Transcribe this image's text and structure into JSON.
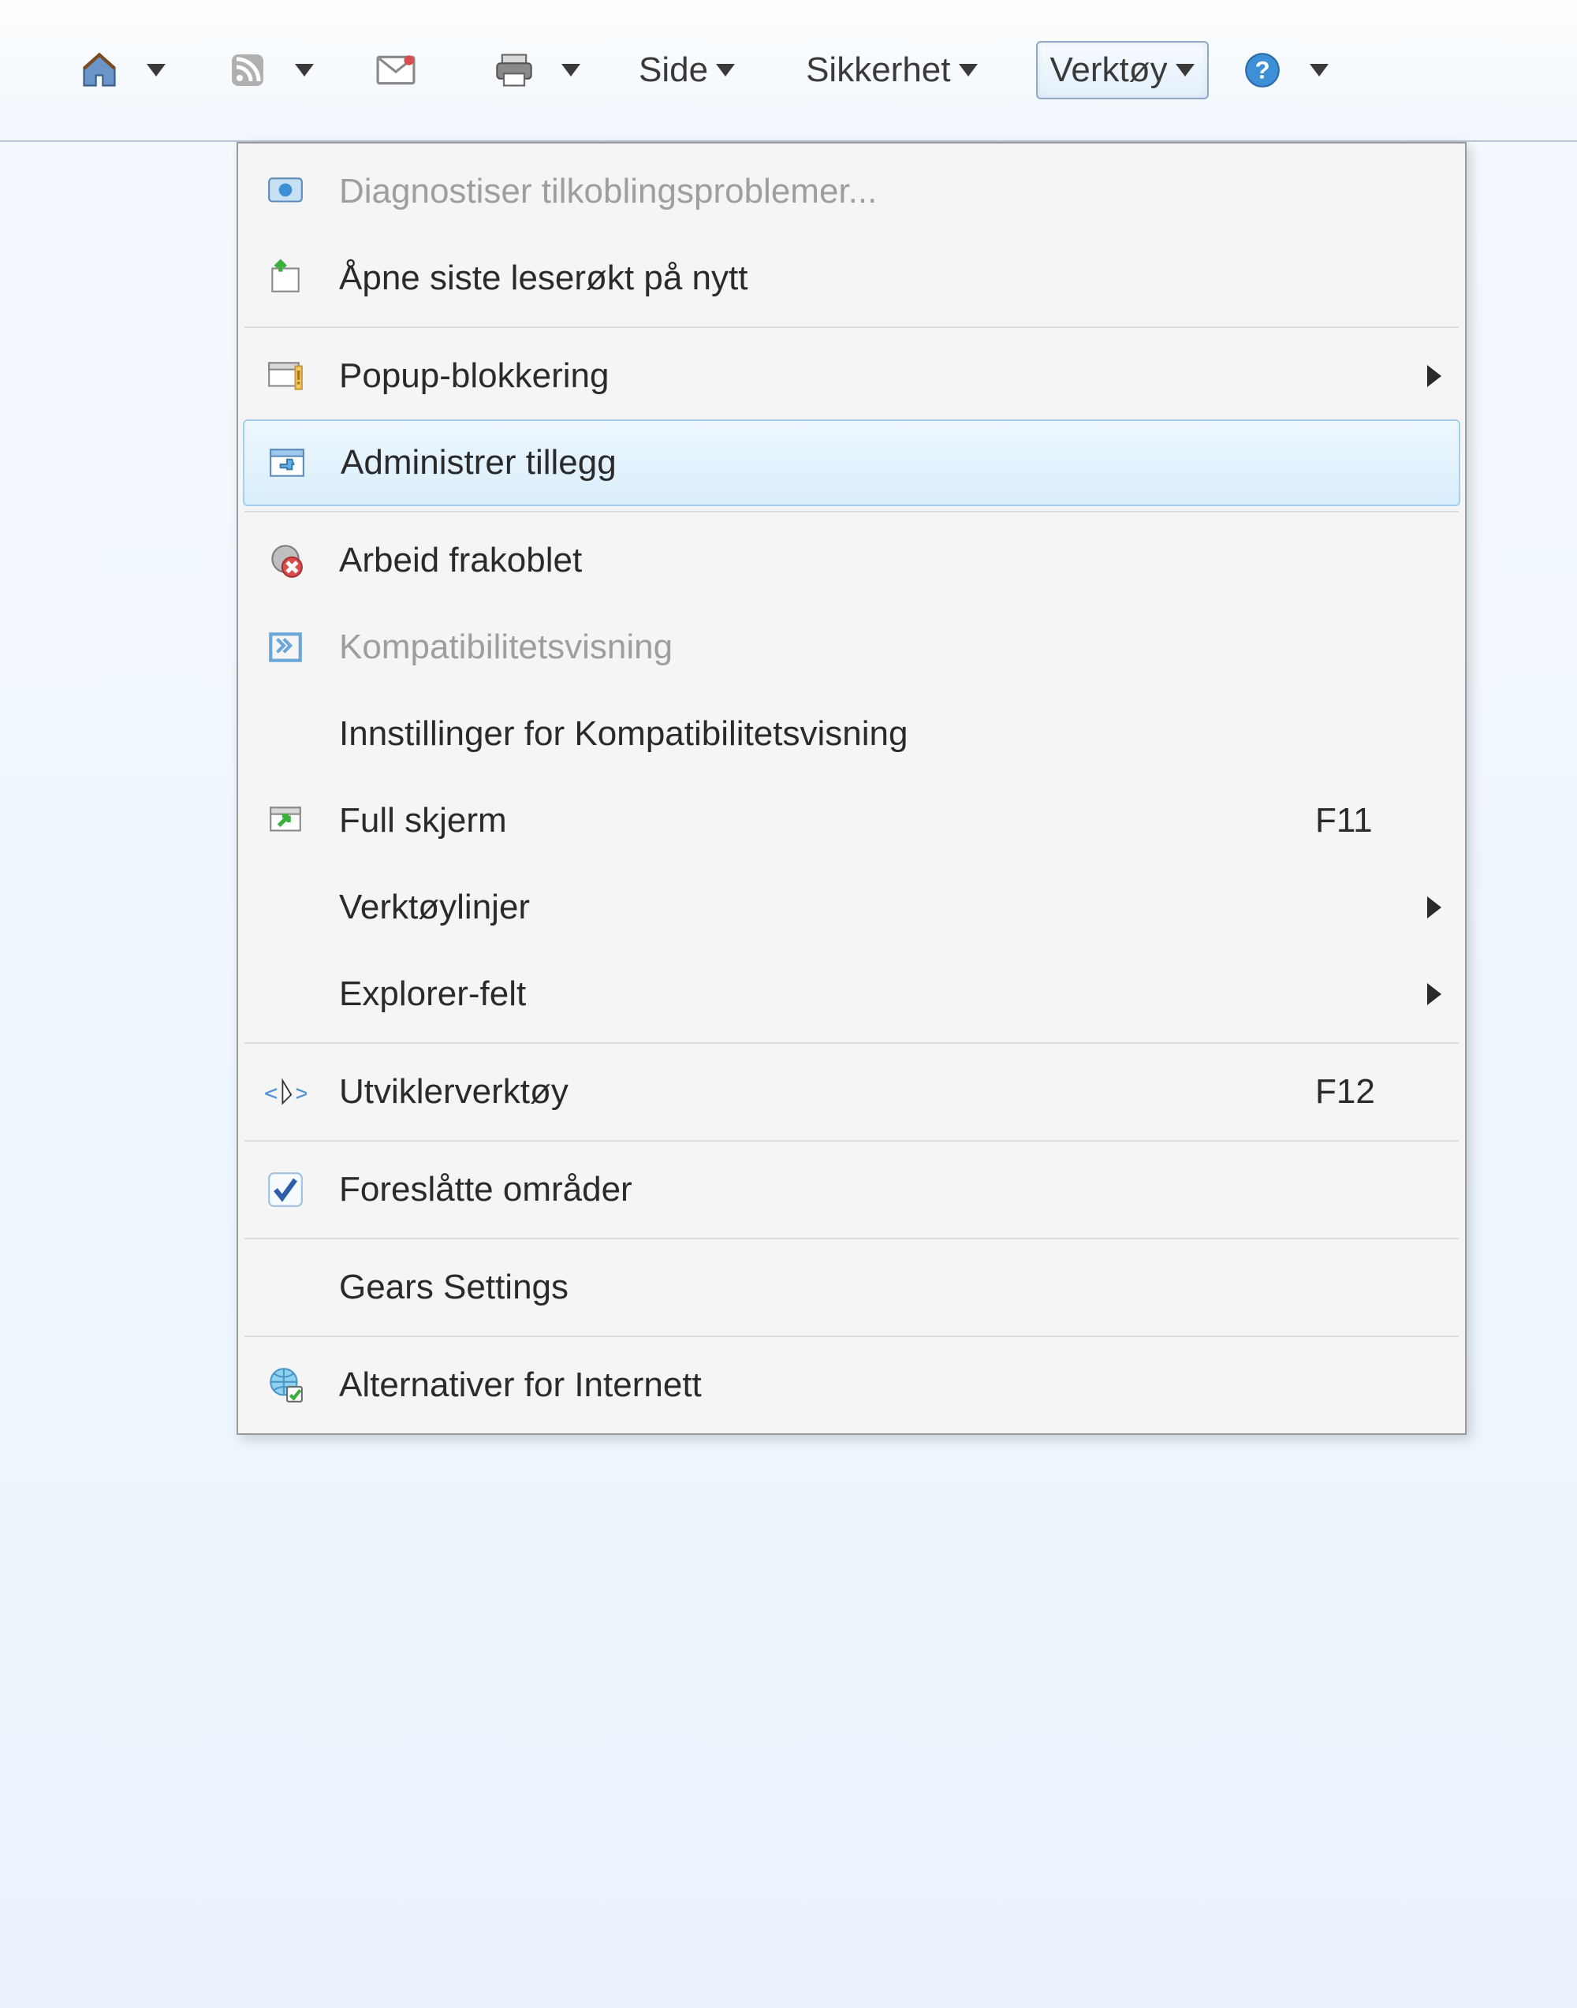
{
  "toolbar": {
    "home_icon": "home",
    "feeds_icon": "rss",
    "mail_icon": "mail",
    "print_icon": "printer",
    "page_label": "Side",
    "security_label": "Sikkerhet",
    "tools_label": "Verktøy",
    "help_icon": "help"
  },
  "menu": {
    "items": [
      {
        "label": "Diagnostiser tilkoblingsproblemer...",
        "disabled": true,
        "icon": "diagnose"
      },
      {
        "label": "Åpne siste leserøkt på nytt",
        "icon": "reopen"
      },
      {
        "separator": true
      },
      {
        "label": "Popup-blokkering",
        "icon": "popup-block",
        "submenu": true
      },
      {
        "label": "Administrer tillegg",
        "icon": "addons",
        "highlight": true
      },
      {
        "separator": true
      },
      {
        "label": "Arbeid frakoblet",
        "icon": "offline"
      },
      {
        "label": "Kompatibilitetsvisning",
        "icon": "compat",
        "disabled": true
      },
      {
        "label": "Innstillinger for Kompatibilitetsvisning"
      },
      {
        "label": "Full skjerm",
        "icon": "fullscreen",
        "shortcut": "F11"
      },
      {
        "label": "Verktøylinjer",
        "submenu": true
      },
      {
        "label": "Explorer-felt",
        "submenu": true
      },
      {
        "separator": true
      },
      {
        "label": "Utviklerverktøy",
        "icon": "devtools",
        "shortcut": "F12"
      },
      {
        "separator": true
      },
      {
        "label": "Foreslåtte områder",
        "icon": "check"
      },
      {
        "separator": true
      },
      {
        "label": "Gears Settings"
      },
      {
        "separator": true
      },
      {
        "label": "Alternativer for Internett",
        "icon": "internet-options"
      }
    ]
  }
}
